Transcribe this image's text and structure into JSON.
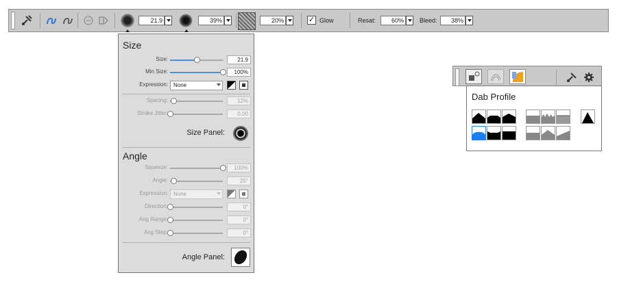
{
  "toolbar": {
    "size_value": "21.9",
    "opacity_value": "39%",
    "texture_value": "20%",
    "glow_label": "Glow",
    "glow_checked": true,
    "resat_label": "Resat:",
    "resat_value": "60%",
    "bleed_label": "Bleed:",
    "bleed_value": "38%"
  },
  "popup": {
    "size_section": {
      "title": "Size",
      "size": {
        "label": "Size:",
        "value": "21.9",
        "fraction": 0.5
      },
      "min_size": {
        "label": "Min Size:",
        "value": "100%",
        "fraction": 1.0
      },
      "expression": {
        "label": "Expression:",
        "value": "None"
      },
      "spacing": {
        "label": "Spacing:",
        "value": "12%",
        "fraction": 0.06
      },
      "stroke_jitter": {
        "label": "Stroke Jitter:",
        "value": "0.00",
        "fraction": 0.0
      },
      "panel_label": "Size Panel:"
    },
    "angle_section": {
      "title": "Angle",
      "squeeze": {
        "label": "Squeeze:",
        "value": "100%",
        "fraction": 1.0
      },
      "angle": {
        "label": "Angle:",
        "value": "25°",
        "fraction": 0.07
      },
      "expression": {
        "label": "Expression:",
        "value": "None"
      },
      "direction": {
        "label": "Direction:",
        "value": "0°",
        "fraction": 0.0
      },
      "ang_range": {
        "label": "Ang Range:",
        "value": "0°",
        "fraction": 0.0
      },
      "ang_step": {
        "label": "Ang Step:",
        "value": "0°",
        "fraction": 0.0
      },
      "panel_label": "Angle Panel:"
    }
  },
  "dab_profile": {
    "title": "Dab Profile",
    "selected_index": 7
  },
  "colors": {
    "accent": "#4a8fdb",
    "selected_profile": "#1e7fe6",
    "bar_bg": "#c9c9c9",
    "popup_bg": "#dcdcdc"
  }
}
